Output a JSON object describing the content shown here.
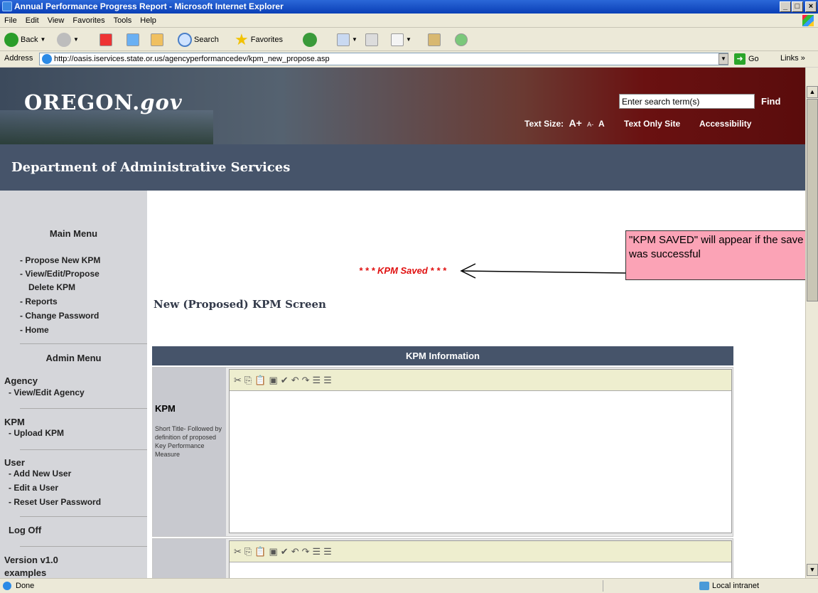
{
  "window": {
    "title": "Annual Performance Progress Report - Microsoft Internet Explorer",
    "controls": [
      "_",
      "□",
      "×"
    ]
  },
  "menu": [
    "File",
    "Edit",
    "View",
    "Favorites",
    "Tools",
    "Help"
  ],
  "toolbar": {
    "back": "Back",
    "search": "Search",
    "favorites": "Favorites"
  },
  "address": {
    "label": "Address",
    "url": "http://oasis.iservices.state.or.us/agencyperformancedev/kpm_new_propose.asp",
    "go": "Go",
    "links": "Links"
  },
  "site": {
    "logo_main": "OREGON.",
    "logo_suffix": "gov",
    "search_placeholder": "Enter search term(s)",
    "find": "Find",
    "text_size_label": "Text Size:",
    "text_size_large": "A+",
    "text_size_small": "A-",
    "text_size_normal": "A",
    "text_only": "Text Only Site",
    "accessibility": "Accessibility",
    "department": "Department of Administrative Services"
  },
  "sidebar": {
    "main_menu": "Main Menu",
    "main_items": [
      "- Propose New KPM",
      "- View/Edit/Propose",
      "Delete KPM",
      "- Reports",
      "- Change Password",
      "- Home"
    ],
    "admin_menu": "Admin Menu",
    "agency": "Agency",
    "agency_item": "- View/Edit Agency",
    "kpm": "KPM",
    "kpm_item": "- Upload KPM",
    "user": "User",
    "user_items": [
      "- Add New User",
      "- Edit a User",
      "- Reset User Password"
    ],
    "logoff": "Log Off",
    "version": "Version v1.0",
    "cut_text": "examples"
  },
  "content": {
    "saved_message": "* * * KPM Saved * * *",
    "callout": "\"KPM SAVED\" will appear if the save was successful",
    "page_title": "New (Proposed) KPM Screen",
    "section_header": "KPM Information",
    "kpm_label": "KPM",
    "kpm_help": "Short Title- Followed by definition of proposed Key Performance Measure"
  },
  "status": {
    "left": "Done",
    "zone": "Local intranet"
  }
}
